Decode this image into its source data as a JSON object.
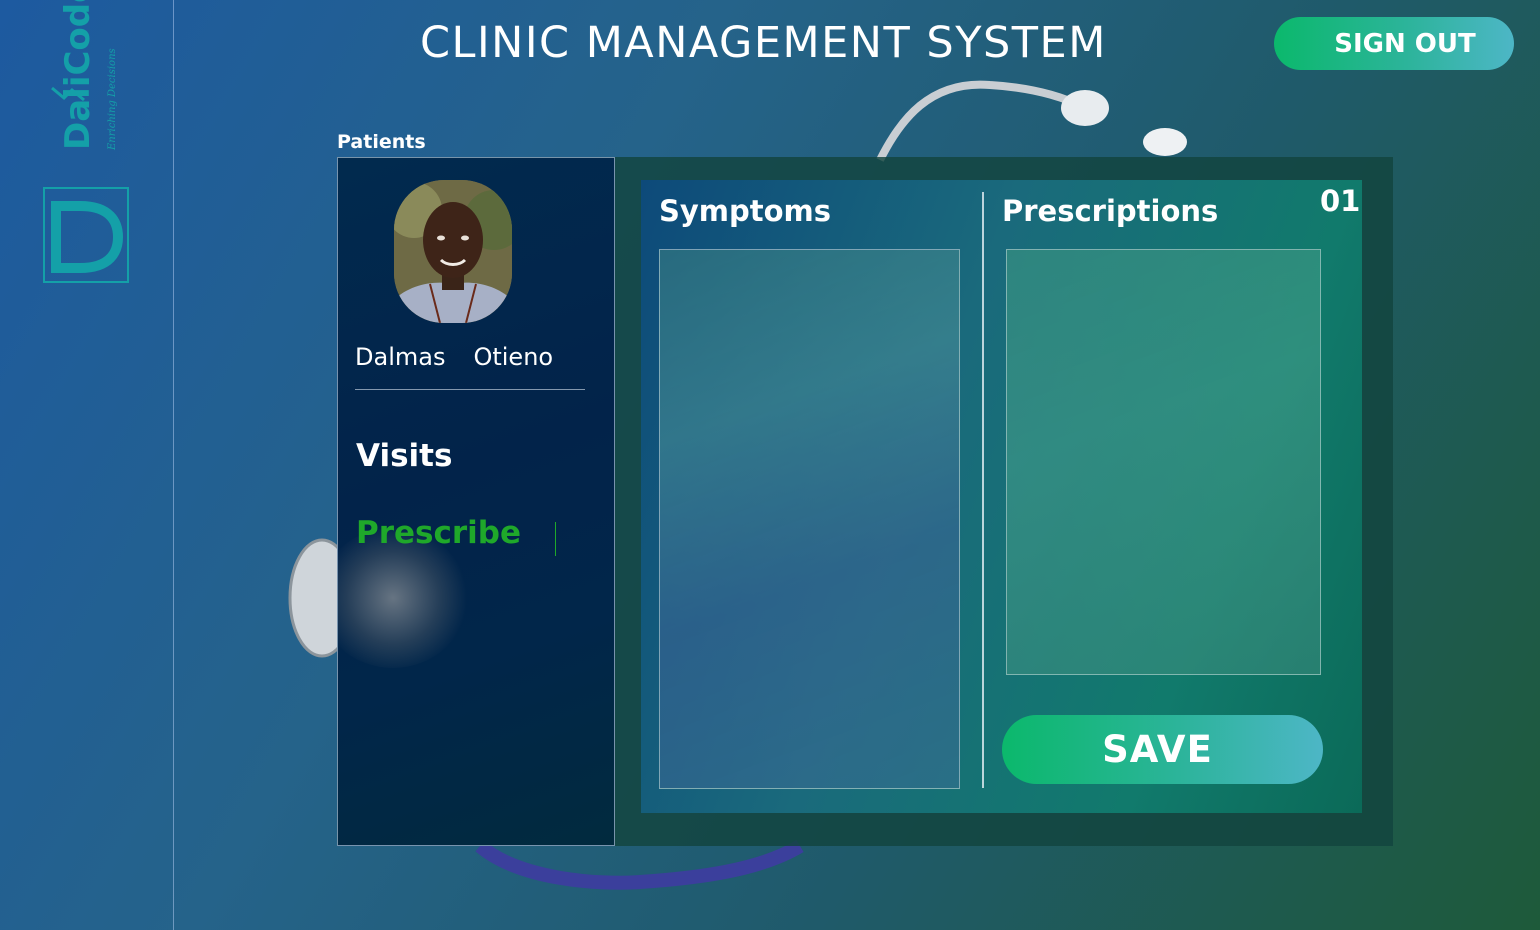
{
  "header": {
    "title": "CLINIC MANAGEMENT SYSTEM",
    "signout_label": "SIGN OUT"
  },
  "logo": {
    "wordmark": "DaliCodes",
    "tagline": "Enriching Decisions"
  },
  "sidebar": {
    "section_label": "Patients",
    "patient": {
      "first_name": "Dalmas",
      "last_name": "Otieno"
    },
    "nav": [
      {
        "label": "Visits",
        "active": false
      },
      {
        "label": "Prescribe",
        "active": true
      }
    ]
  },
  "form": {
    "record_number": "01",
    "symptoms_title": "Symptoms",
    "symptoms_value": "",
    "prescriptions_title": "Prescriptions",
    "prescriptions_value": "",
    "save_label": "SAVE"
  },
  "colors": {
    "accent_green": "#1fa82a",
    "button_gradient_start": "#0bb86c",
    "button_gradient_end": "#4db6c6",
    "panel_navy": "#02234a"
  }
}
